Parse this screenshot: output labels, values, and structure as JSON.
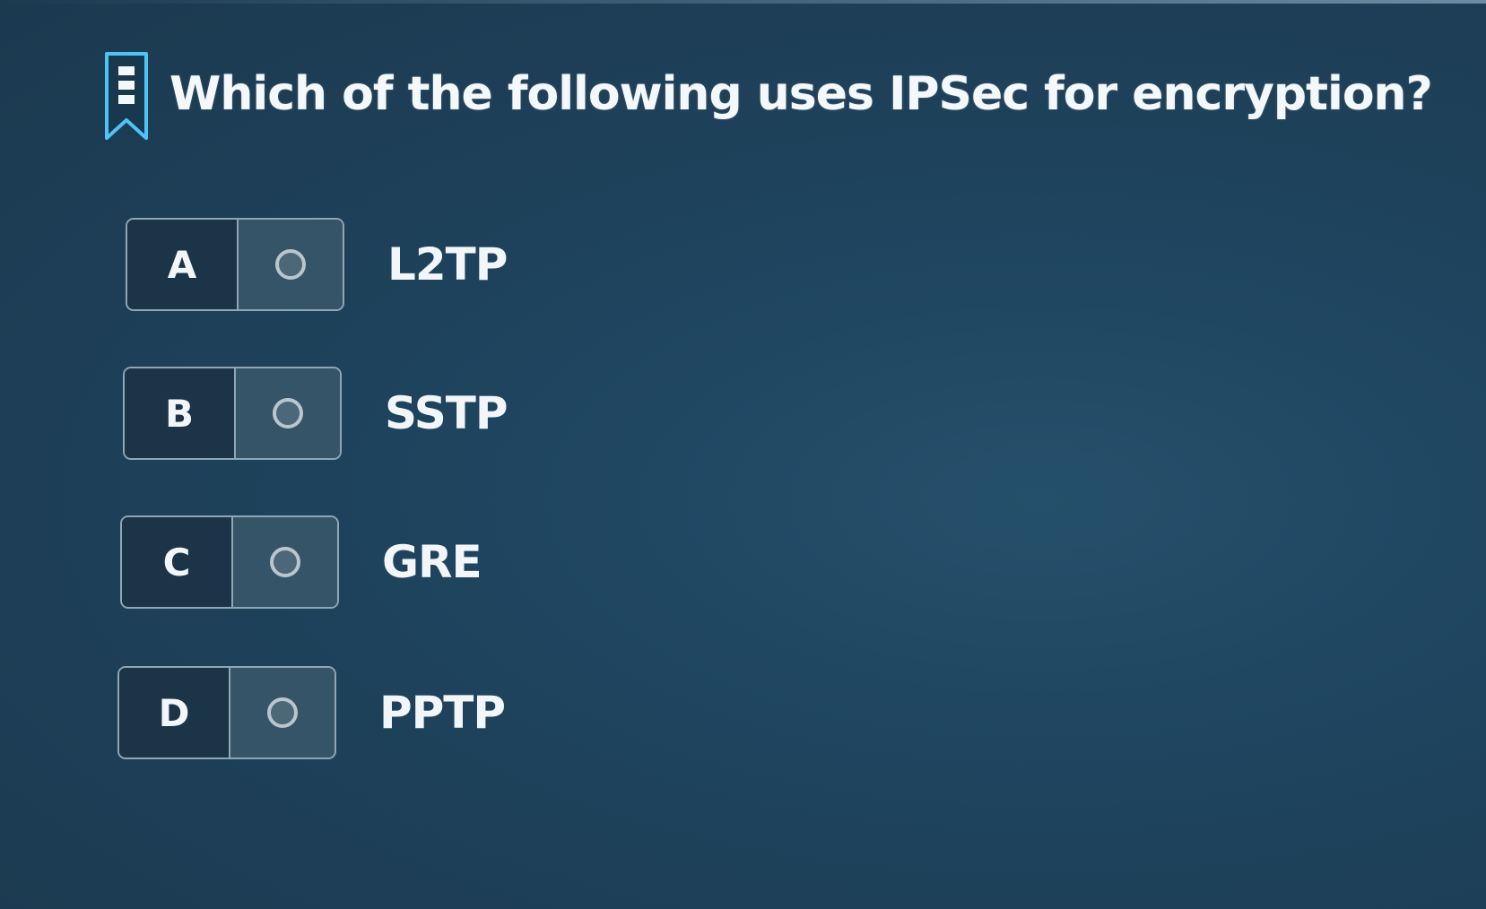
{
  "question": {
    "text": "Which of the following uses IPSec for encryption?",
    "bookmark_icon": "bookmark-icon"
  },
  "options": [
    {
      "letter": "A",
      "label": "L2TP",
      "selected": false
    },
    {
      "letter": "B",
      "label": "SSTP",
      "selected": false
    },
    {
      "letter": "C",
      "label": "GRE",
      "selected": false
    },
    {
      "letter": "D",
      "label": "PPTP",
      "selected": false
    }
  ],
  "colors": {
    "background": "#1f4560",
    "accent": "#4fc3f7",
    "box_border": "#8fa6b4",
    "letter_cell": "#1c3447",
    "radio_cell": "#365468"
  }
}
